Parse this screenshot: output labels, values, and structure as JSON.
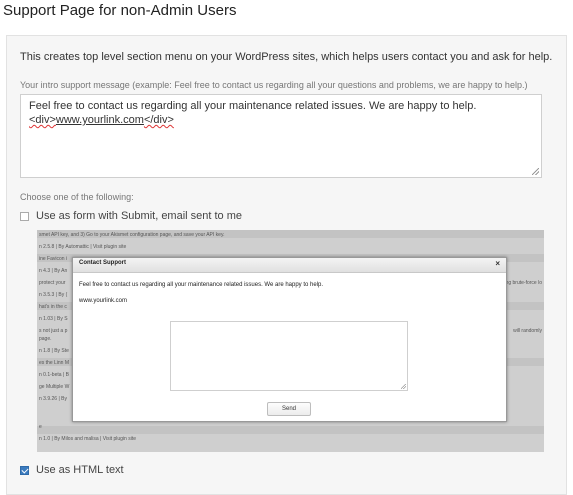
{
  "page": {
    "title": "Support Page for non-Admin Users"
  },
  "panel": {
    "description": "This creates top level section menu on your WordPress sites, which helps users contact you and ask for help.",
    "intro_label": "Your intro support message (example: Feel free to contact us regarding all your questions and problems, we are happy to help.)",
    "intro_value_line1": "Feel free to contact us regarding all your maintenance related issues. We are happy to help.",
    "intro_value_tag_open": "<div>",
    "intro_value_link": "www.yourlink.com",
    "intro_value_tag_close": "</div>",
    "choose_label": "Choose one of the following:",
    "option_form": {
      "label": "Use as form with Submit, email sent to me",
      "checked": false
    },
    "option_html": {
      "label": "Use as HTML text",
      "checked": true
    }
  },
  "preview_bg": {
    "lines": [
      "smet API key, and 3) Go to your Akismet configuration page, and save your API key.",
      "n 2.5.8 | By Automattic | Visit plugin site",
      "ine Favicon i",
      "n 4.3 | By An",
      "protect your",
      "n 3.5.3 | By (",
      "hat's in the c",
      "n 1.03 | By S",
      "s not just a p",
      "page.",
      "n 1.8 | By Ste",
      "es the Linn M",
      "n 0.1-beta | B",
      "ge Multiple W",
      "n 3.9.26 | By",
      "e",
      "n 1.0 | By Milos and malisa | Visit plugin site"
    ],
    "right_fragments": [
      "ng brute-force lo",
      "will randomly"
    ]
  },
  "modal": {
    "title": "Contact Support",
    "close": "×",
    "message": "Feel free to contact us regarding all your maintenance related issues. We are happy to help.",
    "link": "www.yourlink.com",
    "send": "Send"
  }
}
